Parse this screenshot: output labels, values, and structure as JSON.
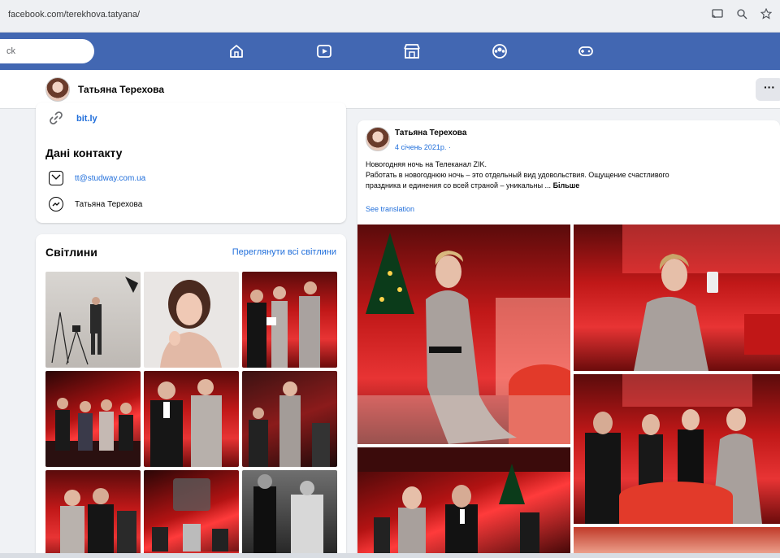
{
  "browser": {
    "url": "facebook.com/terekhova.tatyana/"
  },
  "nav": {
    "search_placeholder": "ck",
    "icons": [
      "home-icon",
      "watch-icon",
      "marketplace-icon",
      "groups-icon",
      "gaming-icon"
    ],
    "accent": "#4267b2"
  },
  "profile_header": {
    "name": "Татьяна Терехова",
    "more_label": "···"
  },
  "intro": {
    "link_text": "bit.ly",
    "contacts_title": "Дані контакту",
    "email": "tt@studway.com.ua",
    "messenger": "Татьяна Терехова"
  },
  "photos": {
    "title": "Світлини",
    "view_all": "Переглянути всі світлини"
  },
  "post": {
    "author": "Татьяна Терехова",
    "date": "4 січень 2021р. ·",
    "line1": "Новогодняя ночь на Телеканал ZIK.",
    "line2": "Работать в новогоднюю ночь – это отдельный вид удовольствия. Ощущение счастливого",
    "line3": "праздника и единения со всей страной – уникальны ...",
    "more": "Більше",
    "see_translation": "See translation"
  }
}
